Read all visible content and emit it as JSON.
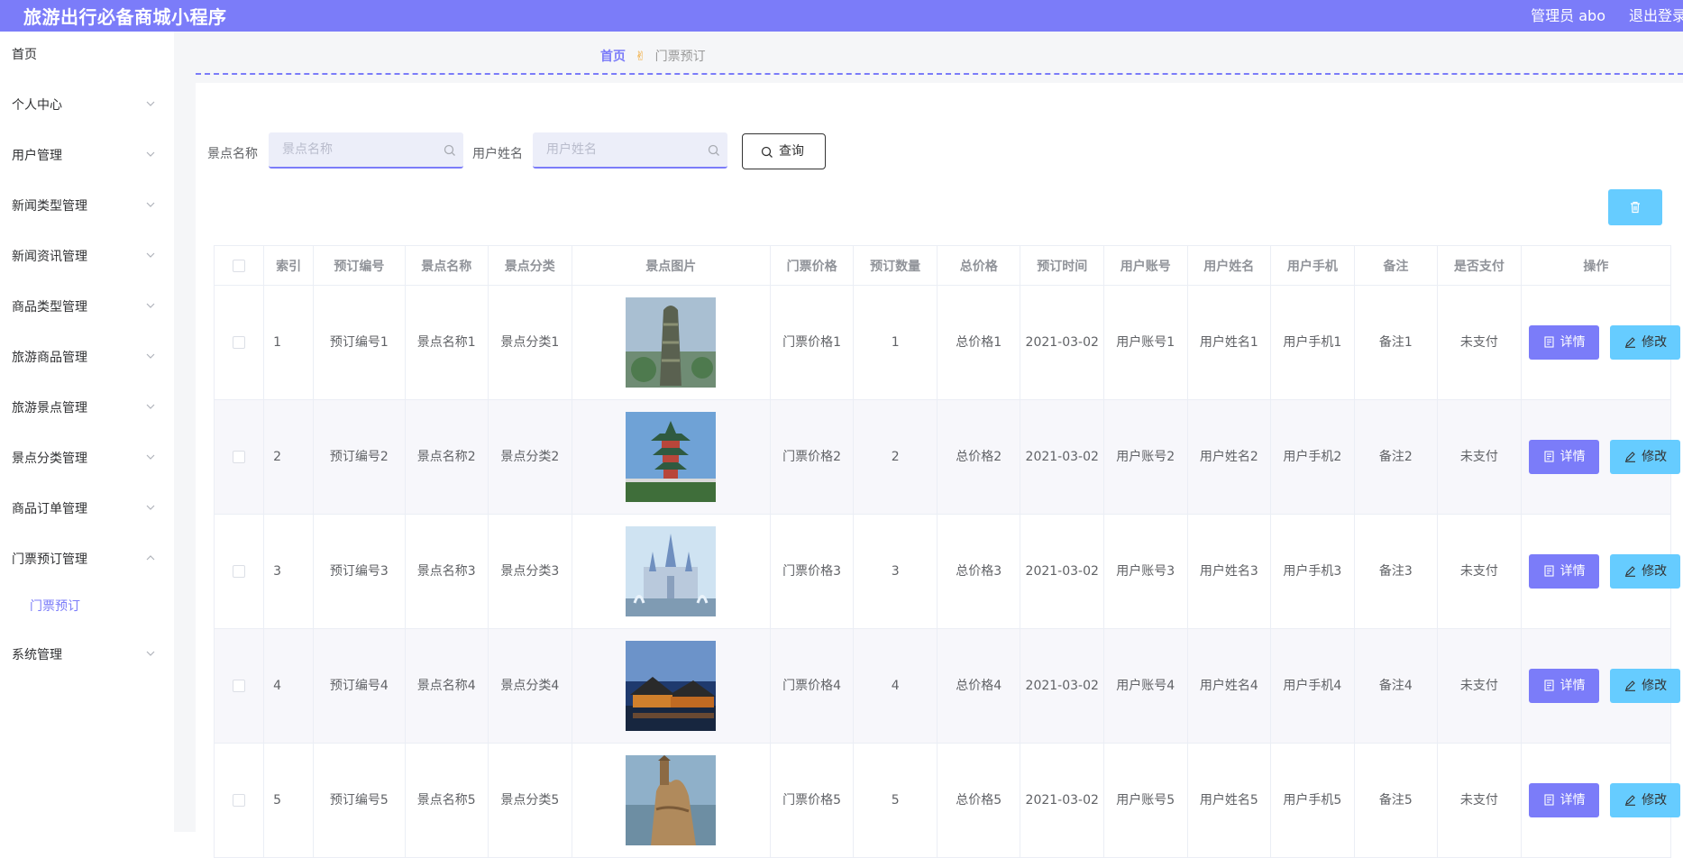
{
  "header": {
    "title": "旅游出行必备商城小程序",
    "admin": "管理员 abo",
    "logout": "退出登录"
  },
  "sidebar": {
    "items": [
      {
        "label": "首页",
        "chevron": false
      },
      {
        "label": "个人中心",
        "chevron": true
      },
      {
        "label": "用户管理",
        "chevron": true
      },
      {
        "label": "新闻类型管理",
        "chevron": true
      },
      {
        "label": "新闻资讯管理",
        "chevron": true
      },
      {
        "label": "商品类型管理",
        "chevron": true
      },
      {
        "label": "旅游商品管理",
        "chevron": true
      },
      {
        "label": "旅游景点管理",
        "chevron": true
      },
      {
        "label": "景点分类管理",
        "chevron": true
      },
      {
        "label": "商品订单管理",
        "chevron": true
      },
      {
        "label": "门票预订管理",
        "chevron": true,
        "expanded": true
      },
      {
        "label": "系统管理",
        "chevron": true
      }
    ],
    "subitem": "门票预订"
  },
  "breadcrumb": {
    "home": "首页",
    "current": "门票预订"
  },
  "filters": {
    "spot_label": "景点名称",
    "spot_placeholder": "景点名称",
    "user_label": "用户姓名",
    "user_placeholder": "用户姓名",
    "query_label": "查询"
  },
  "table": {
    "headers": [
      "索引",
      "预订编号",
      "景点名称",
      "景点分类",
      "景点图片",
      "门票价格",
      "预订数量",
      "总价格",
      "预订时间",
      "用户账号",
      "用户姓名",
      "用户手机",
      "备注",
      "是否支付",
      "操作"
    ],
    "rows": [
      [
        "1",
        "预订编号1",
        "景点名称1",
        "景点分类1",
        "门票价格1",
        "1",
        "总价格1",
        "2021-03-02",
        "用户账号1",
        "用户姓名1",
        "用户手机1",
        "备注1",
        "未支付"
      ],
      [
        "2",
        "预订编号2",
        "景点名称2",
        "景点分类2",
        "门票价格2",
        "2",
        "总价格2",
        "2021-03-02",
        "用户账号2",
        "用户姓名2",
        "用户手机2",
        "备注2",
        "未支付"
      ],
      [
        "3",
        "预订编号3",
        "景点名称3",
        "景点分类3",
        "门票价格3",
        "3",
        "总价格3",
        "2021-03-02",
        "用户账号3",
        "用户姓名3",
        "用户手机3",
        "备注3",
        "未支付"
      ],
      [
        "4",
        "预订编号4",
        "景点名称4",
        "景点分类4",
        "门票价格4",
        "4",
        "总价格4",
        "2021-03-02",
        "用户账号4",
        "用户姓名4",
        "用户手机4",
        "备注4",
        "未支付"
      ],
      [
        "5",
        "预订编号5",
        "景点名称5",
        "景点分类5",
        "门票价格5",
        "5",
        "总价格5",
        "2021-03-02",
        "用户账号5",
        "用户姓名5",
        "用户手机5",
        "备注5",
        "未支付"
      ]
    ],
    "actions": {
      "detail": "详情",
      "edit": "修改",
      "delete": "删除"
    }
  },
  "colors": {
    "accent": "#7b7cf9",
    "edit": "#66ccff",
    "delete": "#ccf04b"
  }
}
